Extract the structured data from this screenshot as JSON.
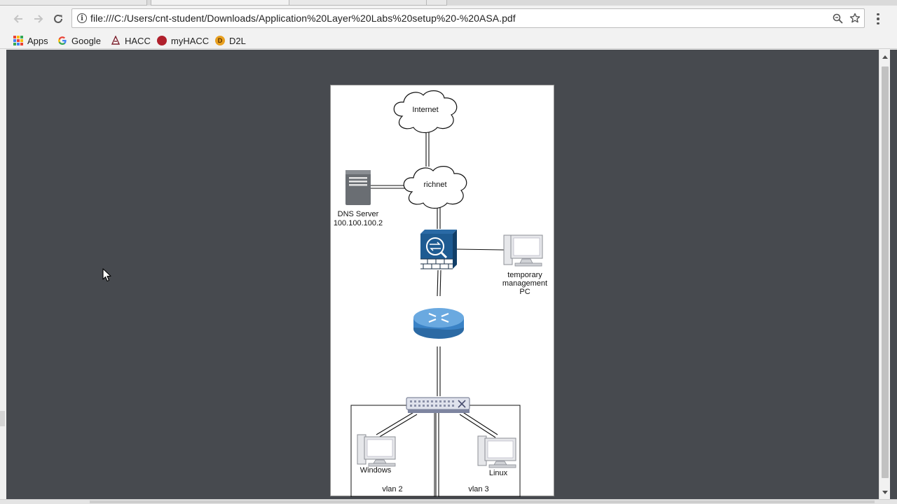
{
  "browser": {
    "url": "file:///C:/Users/cnt-student/Downloads/Application%20Layer%20Labs%20setup%20-%20ASA.pdf",
    "bookmarks": [
      {
        "label": "Apps",
        "icon": "apps-grid-icon"
      },
      {
        "label": "Google",
        "icon": "google-icon"
      },
      {
        "label": "HACC",
        "icon": "hacc-icon"
      },
      {
        "label": "myHACC",
        "icon": "myhacc-icon"
      },
      {
        "label": "D2L",
        "icon": "d2l-icon"
      }
    ],
    "colors": {
      "viewer_background": "#474a4f",
      "toolbar": "#f2f2f2",
      "google_blue": "#4285f4",
      "myhacc_red": "#b0202c",
      "d2l_orange": "#e8a020"
    }
  },
  "diagram": {
    "internet": "Internet",
    "richnet": "richnet",
    "dns_server": "DNS Server",
    "dns_ip": "100.100.100.2",
    "mgmt_pc": [
      "temporary",
      "management",
      "PC"
    ],
    "windows": "Windows",
    "linux": "Linux",
    "vlan2": "vlan 2",
    "vlan3": "vlan 3",
    "icons": [
      "cloud-icon",
      "server-icon",
      "firewall-icon",
      "router-icon",
      "switch-icon",
      "desktop-pc-icon"
    ]
  }
}
